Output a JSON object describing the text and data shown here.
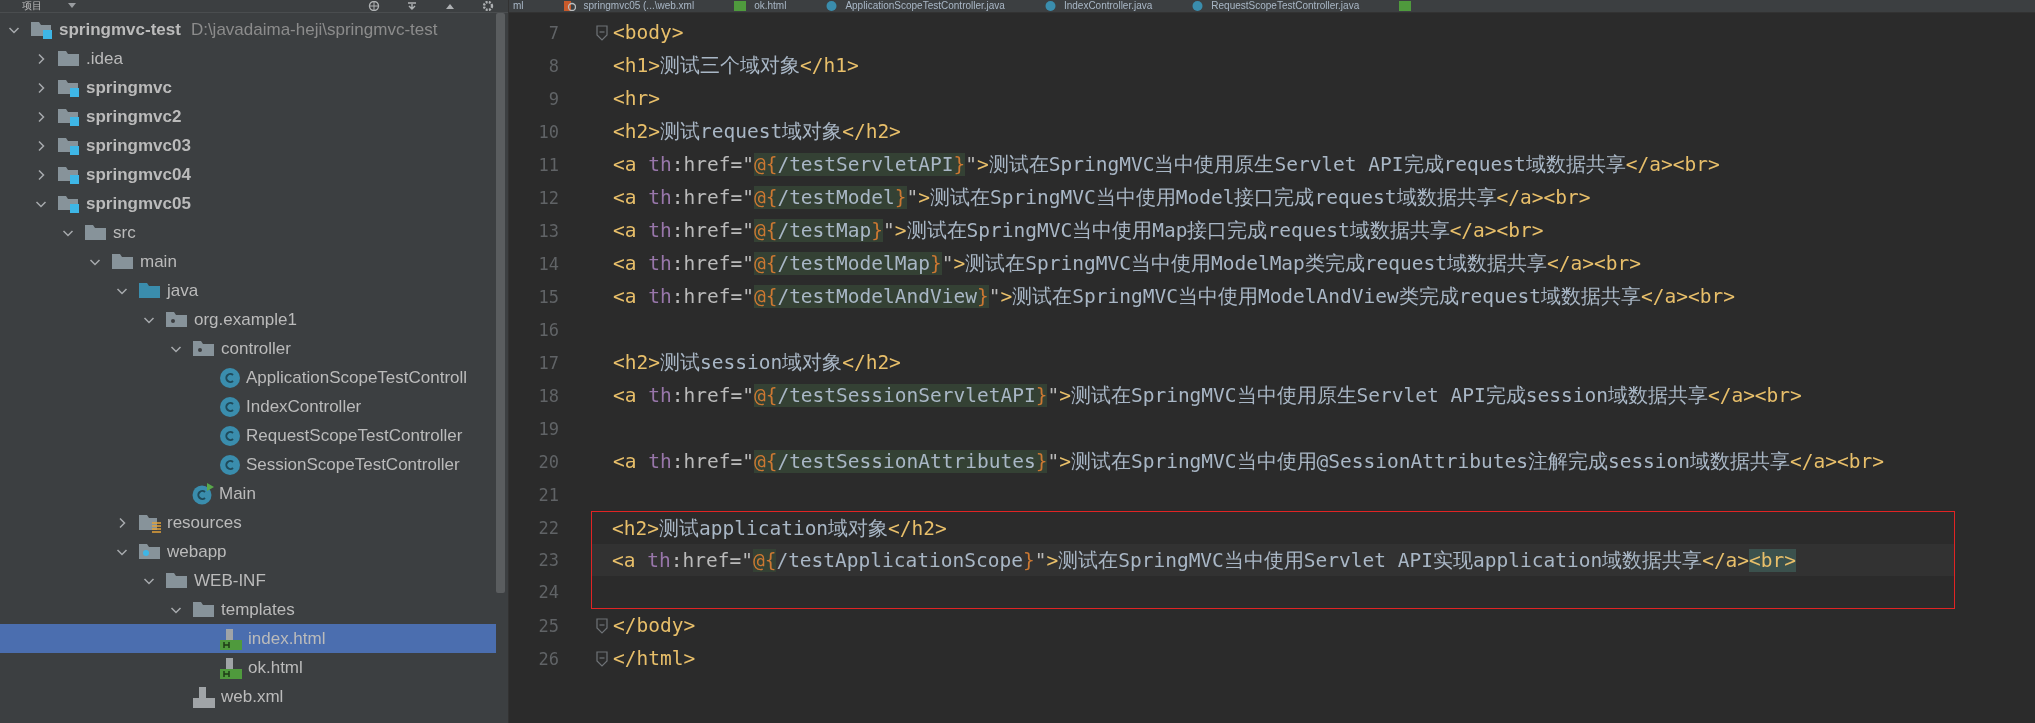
{
  "project_panel": {
    "title": "项目",
    "tree": [
      {
        "name": "springmvc-test",
        "path": "D:\\javadaima-heji\\springmvc-test",
        "kind": "module",
        "expanded": true,
        "selected": false,
        "children": [
          {
            "name": ".idea",
            "kind": "folder",
            "expanded": false,
            "selected": false
          },
          {
            "name": "springmvc",
            "kind": "module",
            "expanded": false,
            "selected": false
          },
          {
            "name": "springmvc2",
            "kind": "module",
            "expanded": false,
            "selected": false
          },
          {
            "name": "springmvc03",
            "kind": "module",
            "expanded": false,
            "selected": false
          },
          {
            "name": "springmvc04",
            "kind": "module",
            "expanded": false,
            "selected": false
          },
          {
            "name": "springmvc05",
            "kind": "module",
            "expanded": true,
            "selected": false,
            "children": [
              {
                "name": "src",
                "kind": "folder",
                "expanded": true,
                "selected": false,
                "children": [
                  {
                    "name": "main",
                    "kind": "folder",
                    "expanded": true,
                    "selected": false,
                    "children": [
                      {
                        "name": "java",
                        "kind": "source-folder",
                        "expanded": true,
                        "selected": false,
                        "children": [
                          {
                            "name": "org.example1",
                            "kind": "package",
                            "expanded": true,
                            "selected": false,
                            "children": [
                              {
                                "name": "controller",
                                "kind": "package",
                                "expanded": true,
                                "selected": false,
                                "children": [
                                  {
                                    "name": "ApplicationScopeTestControll",
                                    "kind": "class",
                                    "selected": false
                                  },
                                  {
                                    "name": "IndexController",
                                    "kind": "class",
                                    "selected": false
                                  },
                                  {
                                    "name": "RequestScopeTestController",
                                    "kind": "class",
                                    "selected": false
                                  },
                                  {
                                    "name": "SessionScopeTestController",
                                    "kind": "class",
                                    "selected": false
                                  }
                                ]
                              },
                              {
                                "name": "Main",
                                "kind": "main-class",
                                "selected": false
                              }
                            ]
                          }
                        ]
                      },
                      {
                        "name": "resources",
                        "kind": "resources-folder",
                        "expanded": false,
                        "selected": false
                      },
                      {
                        "name": "webapp",
                        "kind": "web-folder",
                        "expanded": true,
                        "selected": false,
                        "children": [
                          {
                            "name": "WEB-INF",
                            "kind": "folder",
                            "expanded": true,
                            "selected": false,
                            "children": [
                              {
                                "name": "templates",
                                "kind": "folder",
                                "expanded": true,
                                "selected": false,
                                "children": [
                                  {
                                    "name": "index.html",
                                    "kind": "html",
                                    "selected": true
                                  },
                                  {
                                    "name": "ok.html",
                                    "kind": "html",
                                    "selected": false
                                  }
                                ]
                              },
                              {
                                "name": "web.xml",
                                "kind": "xml",
                                "selected": false
                              }
                            ]
                          }
                        ]
                      }
                    ]
                  }
                ]
              }
            ]
          }
        ]
      }
    ]
  },
  "editor_tabs": [
    {
      "label": "ml",
      "kind": "none"
    },
    {
      "label": "springmvc05 (...\\web.xml",
      "kind": "xml"
    },
    {
      "label": "ok.html",
      "kind": "html"
    },
    {
      "label": "ApplicationScopeTestController.java",
      "kind": "class"
    },
    {
      "label": "IndexController.java",
      "kind": "class"
    },
    {
      "label": "RequestScopeTestController.java",
      "kind": "class"
    },
    {
      "kind": "html"
    }
  ],
  "code_lines": [
    {
      "number": "7",
      "fold": true,
      "current": false,
      "boxed": false,
      "segments": [
        {
          "kind": "tag",
          "text": "<body>"
        }
      ]
    },
    {
      "number": "8",
      "fold": false,
      "current": false,
      "boxed": false,
      "segments": [
        {
          "kind": "tag",
          "text": "<h1>"
        },
        {
          "kind": "text",
          "text": "测试三个域对象"
        },
        {
          "kind": "tag",
          "text": "</h1>"
        }
      ]
    },
    {
      "number": "9",
      "fold": false,
      "current": false,
      "boxed": false,
      "segments": [
        {
          "kind": "tag",
          "text": "<hr>"
        }
      ]
    },
    {
      "number": "10",
      "fold": false,
      "current": false,
      "boxed": false,
      "segments": [
        {
          "kind": "tag",
          "text": "<h2>"
        },
        {
          "kind": "text",
          "text": "测试request域对象"
        },
        {
          "kind": "tag",
          "text": "</h2>"
        }
      ]
    },
    {
      "number": "11",
      "fold": false,
      "current": false,
      "boxed": false,
      "segments": [
        {
          "kind": "tag",
          "text": "<a "
        },
        {
          "kind": "ns",
          "text": "th"
        },
        {
          "kind": "attr",
          "text": ":href=\""
        },
        {
          "kind": "brace",
          "text": "@{"
        },
        {
          "kind": "expr",
          "text": "/testServletAPI"
        },
        {
          "kind": "brace",
          "text": "}"
        },
        {
          "kind": "attr",
          "text": "\""
        },
        {
          "kind": "tag",
          "text": ">"
        },
        {
          "kind": "text",
          "text": "测试在SpringMVC当中使用原生Servlet API完成request域数据共享"
        },
        {
          "kind": "tag",
          "text": "</a><br>"
        }
      ]
    },
    {
      "number": "12",
      "fold": false,
      "current": false,
      "boxed": false,
      "segments": [
        {
          "kind": "tag",
          "text": "<a "
        },
        {
          "kind": "ns",
          "text": "th"
        },
        {
          "kind": "attr",
          "text": ":href=\""
        },
        {
          "kind": "brace",
          "text": "@{"
        },
        {
          "kind": "expr",
          "text": "/testModel"
        },
        {
          "kind": "brace",
          "text": "}"
        },
        {
          "kind": "attr",
          "text": "\""
        },
        {
          "kind": "tag",
          "text": ">"
        },
        {
          "kind": "text",
          "text": "测试在SpringMVC当中使用Model接口完成request域数据共享"
        },
        {
          "kind": "tag",
          "text": "</a><br>"
        }
      ]
    },
    {
      "number": "13",
      "fold": false,
      "current": false,
      "boxed": false,
      "segments": [
        {
          "kind": "tag",
          "text": "<a "
        },
        {
          "kind": "ns",
          "text": "th"
        },
        {
          "kind": "attr",
          "text": ":href=\""
        },
        {
          "kind": "brace",
          "text": "@{"
        },
        {
          "kind": "expr",
          "text": "/testMap"
        },
        {
          "kind": "brace",
          "text": "}"
        },
        {
          "kind": "attr",
          "text": "\""
        },
        {
          "kind": "tag",
          "text": ">"
        },
        {
          "kind": "text",
          "text": "测试在SpringMVC当中使用Map接口完成request域数据共享"
        },
        {
          "kind": "tag",
          "text": "</a><br>"
        }
      ]
    },
    {
      "number": "14",
      "fold": false,
      "current": false,
      "boxed": false,
      "segments": [
        {
          "kind": "tag",
          "text": "<a "
        },
        {
          "kind": "ns",
          "text": "th"
        },
        {
          "kind": "attr",
          "text": ":href=\""
        },
        {
          "kind": "brace",
          "text": "@{"
        },
        {
          "kind": "expr",
          "text": "/testModelMap"
        },
        {
          "kind": "brace",
          "text": "}"
        },
        {
          "kind": "attr",
          "text": "\""
        },
        {
          "kind": "tag",
          "text": ">"
        },
        {
          "kind": "text",
          "text": "测试在SpringMVC当中使用ModelMap类完成request域数据共享"
        },
        {
          "kind": "tag",
          "text": "</a><br>"
        }
      ]
    },
    {
      "number": "15",
      "fold": false,
      "current": false,
      "boxed": false,
      "segments": [
        {
          "kind": "tag",
          "text": "<a "
        },
        {
          "kind": "ns",
          "text": "th"
        },
        {
          "kind": "attr",
          "text": ":href=\""
        },
        {
          "kind": "brace",
          "text": "@{"
        },
        {
          "kind": "expr",
          "text": "/testModelAndView"
        },
        {
          "kind": "brace",
          "text": "}"
        },
        {
          "kind": "attr",
          "text": "\""
        },
        {
          "kind": "tag",
          "text": ">"
        },
        {
          "kind": "text",
          "text": "测试在SpringMVC当中使用ModelAndView类完成request域数据共享"
        },
        {
          "kind": "tag",
          "text": "</a><br>"
        }
      ]
    },
    {
      "number": "16",
      "fold": false,
      "current": false,
      "boxed": false
    },
    {
      "number": "17",
      "fold": false,
      "current": false,
      "boxed": false,
      "segments": [
        {
          "kind": "tag",
          "text": "<h2>"
        },
        {
          "kind": "text",
          "text": "测试session域对象"
        },
        {
          "kind": "tag",
          "text": "</h2>"
        }
      ]
    },
    {
      "number": "18",
      "fold": false,
      "current": false,
      "boxed": false,
      "segments": [
        {
          "kind": "tag",
          "text": "<a "
        },
        {
          "kind": "ns",
          "text": "th"
        },
        {
          "kind": "attr",
          "text": ":href=\""
        },
        {
          "kind": "brace",
          "text": "@{"
        },
        {
          "kind": "expr",
          "text": "/testSessionServletAPI"
        },
        {
          "kind": "brace",
          "text": "}"
        },
        {
          "kind": "attr",
          "text": "\""
        },
        {
          "kind": "tag",
          "text": ">"
        },
        {
          "kind": "text",
          "text": "测试在SpringMVC当中使用原生Servlet API完成session域数据共享"
        },
        {
          "kind": "tag",
          "text": "</a><br>"
        }
      ]
    },
    {
      "number": "19",
      "fold": false,
      "current": false,
      "boxed": false
    },
    {
      "number": "20",
      "fold": false,
      "current": false,
      "boxed": false,
      "segments": [
        {
          "kind": "tag",
          "text": "<a "
        },
        {
          "kind": "ns",
          "text": "th"
        },
        {
          "kind": "attr",
          "text": ":href=\""
        },
        {
          "kind": "brace",
          "text": "@{"
        },
        {
          "kind": "expr",
          "text": "/testSessionAttributes"
        },
        {
          "kind": "brace",
          "text": "}"
        },
        {
          "kind": "attr",
          "text": "\""
        },
        {
          "kind": "tag",
          "text": ">"
        },
        {
          "kind": "text",
          "text": "测试在SpringMVC当中使用@SessionAttributes注解完成session域数据共享"
        },
        {
          "kind": "tag",
          "text": "</a><br>"
        }
      ]
    },
    {
      "number": "21",
      "fold": false,
      "current": false,
      "boxed": false
    },
    {
      "number": "22",
      "fold": false,
      "current": false,
      "boxed": true,
      "segments": [
        {
          "kind": "tag",
          "text": "<h2>"
        },
        {
          "kind": "text",
          "text": "测试application域对象"
        },
        {
          "kind": "tag",
          "text": "</h2>"
        }
      ]
    },
    {
      "number": "23",
      "fold": false,
      "current": true,
      "boxed": true,
      "segments": [
        {
          "kind": "tag",
          "text": "<a "
        },
        {
          "kind": "ns",
          "text": "th"
        },
        {
          "kind": "attr",
          "text": ":href=\""
        },
        {
          "kind": "brace",
          "text": "@{"
        },
        {
          "kind": "plain",
          "text": "/testApplicationScope"
        },
        {
          "kind": "brace-plain",
          "text": "}"
        },
        {
          "kind": "attr",
          "text": "\""
        },
        {
          "kind": "tag",
          "text": ">"
        },
        {
          "kind": "text",
          "text": "测试在SpringMVC当中使用Servlet API实现application域数据共享"
        },
        {
          "kind": "tag",
          "text": "</a>"
        },
        {
          "kind": "tag-match",
          "text": "<br>"
        }
      ]
    },
    {
      "number": "24",
      "fold": false,
      "current": false,
      "boxed": true
    },
    {
      "number": "25",
      "fold": true,
      "current": false,
      "boxed": false,
      "segments": [
        {
          "kind": "tag",
          "text": "</body>"
        }
      ]
    },
    {
      "number": "26",
      "fold": true,
      "current": false,
      "boxed": false,
      "segments": [
        {
          "kind": "tag",
          "text": "</html>"
        }
      ]
    }
  ]
}
